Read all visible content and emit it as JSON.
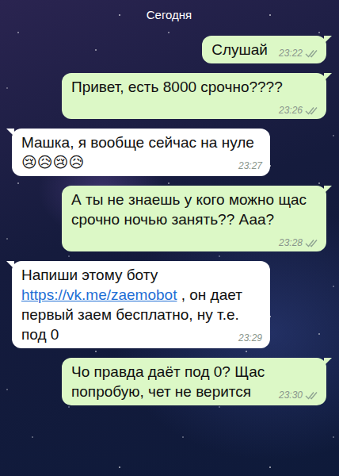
{
  "header": {
    "date": "Сегодня"
  },
  "messages": [
    {
      "kind": "sent",
      "parts": [
        {
          "text": "Слушай",
          "link": false
        }
      ],
      "time": "23:22",
      "read": false
    },
    {
      "kind": "sent",
      "parts": [
        {
          "text": "Привет, есть 8000 срочно????",
          "link": false
        }
      ],
      "time": "23:26",
      "read": false
    },
    {
      "kind": "received",
      "parts": [
        {
          "text": "Машка, я вообще сейчас на нуле 😢😥😢😥",
          "link": false
        }
      ],
      "time": "23:27"
    },
    {
      "kind": "sent",
      "parts": [
        {
          "text": "А ты не знаешь у кого можно щас срочно ночью занять?? Ааа?",
          "link": false
        }
      ],
      "time": "23:28",
      "read": false
    },
    {
      "kind": "received",
      "parts": [
        {
          "text": "Напиши этому боту ",
          "link": false
        },
        {
          "text": "https://vk.me/zaemobot",
          "link": true
        },
        {
          "text": " , он дает первый заем бесплатно, ну т.е. под 0",
          "link": false
        }
      ],
      "time": "23:29"
    },
    {
      "kind": "sent",
      "parts": [
        {
          "text": "Чо правда даёт под 0? Щас попробую, чет не верится",
          "link": false
        }
      ],
      "time": "23:30",
      "read": false
    }
  ]
}
